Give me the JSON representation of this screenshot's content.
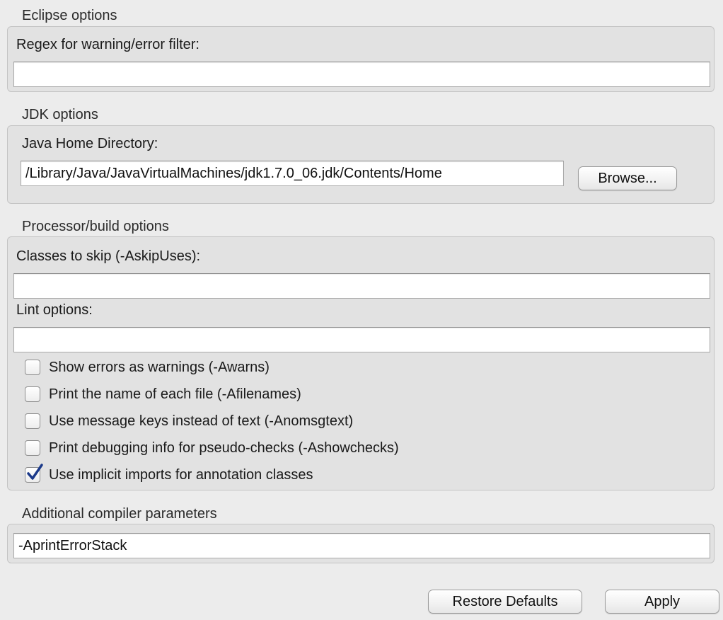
{
  "eclipse": {
    "title": "Eclipse options",
    "regex_label": "Regex for warning/error filter:",
    "regex_value": ""
  },
  "jdk": {
    "title": "JDK options",
    "home_label": "Java Home Directory:",
    "home_value": "/Library/Java/JavaVirtualMachines/jdk1.7.0_06.jdk/Contents/Home",
    "browse_label": "Browse..."
  },
  "processor": {
    "title": "Processor/build options",
    "skip_label": "Classes to skip (-AskipUses):",
    "skip_value": "",
    "lint_label": "Lint options:",
    "lint_value": "",
    "checkboxes": [
      {
        "label": "Show errors as warnings (-Awarns)",
        "checked": false
      },
      {
        "label": "Print the name of each file (-Afilenames)",
        "checked": false
      },
      {
        "label": "Use message keys instead of text (-Anomsgtext)",
        "checked": false
      },
      {
        "label": "Print debugging info for pseudo-checks (-Ashowchecks)",
        "checked": false
      },
      {
        "label": "Use implicit imports for annotation classes",
        "checked": true
      }
    ]
  },
  "compiler": {
    "title": "Additional compiler parameters",
    "params_value": "-AprintErrorStack"
  },
  "footer": {
    "restore_label": "Restore Defaults",
    "apply_label": "Apply"
  },
  "colors": {
    "checkmark": "#1c3a8a"
  }
}
